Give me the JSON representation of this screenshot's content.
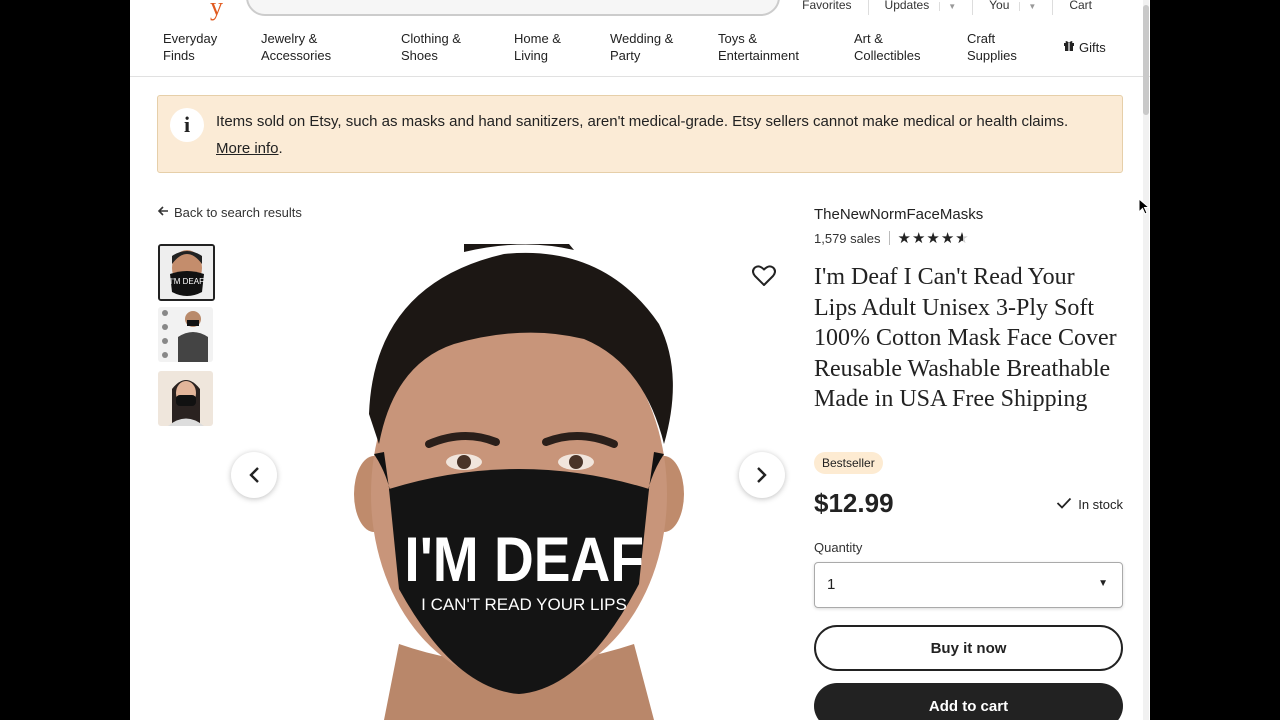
{
  "header": {
    "logo_fragment": "y",
    "top_links": [
      {
        "label": "Favorites",
        "has_caret": false
      },
      {
        "label": "Updates",
        "has_caret": true
      },
      {
        "label": "You",
        "has_caret": true
      },
      {
        "label": "Cart",
        "has_caret": false
      }
    ]
  },
  "categories": [
    {
      "label": "Everyday\nFinds"
    },
    {
      "label": "Jewelry &\nAccessories"
    },
    {
      "label": "Clothing &\nShoes"
    },
    {
      "label": "Home &\nLiving"
    },
    {
      "label": "Wedding &\nParty"
    },
    {
      "label": "Toys &\nEntertainment"
    },
    {
      "label": "Art &\nCollectibles"
    },
    {
      "label": "Craft\nSupplies"
    },
    {
      "label": "Gifts",
      "icon": "gift-icon"
    }
  ],
  "banner": {
    "icon": "info-icon",
    "icon_glyph": "i",
    "text": "Items sold on Etsy, such as masks and hand sanitizers, aren't medical-grade. Etsy sellers cannot make medical or health claims.",
    "link": "More info",
    "suffix": "."
  },
  "back_link": "Back to search results",
  "gallery": {
    "mask_line1": "I'M DEAF",
    "mask_line2": "I CAN'T READ YOUR LIPS",
    "thumb_text": "I'M DEAF"
  },
  "product": {
    "shop_name": "TheNewNormFaceMasks",
    "sales": "1,579 sales",
    "rating": 4.5,
    "title": "I'm Deaf I Can't Read Your Lips Adult Unisex 3-Ply Soft 100% Cotton Mask Face Cover Reusable Washable Breathable Made in USA Free Shipping",
    "badge": "Bestseller",
    "price": "$12.99",
    "stock": "In stock",
    "quantity_label": "Quantity",
    "quantity_value": "1",
    "buy_now": "Buy it now",
    "add_to_cart": "Add to cart"
  },
  "colors": {
    "banner_bg": "#fbebd6",
    "badge_bg": "#fdebd2",
    "primary_button": "#222222",
    "logo": "#e05a1f"
  }
}
